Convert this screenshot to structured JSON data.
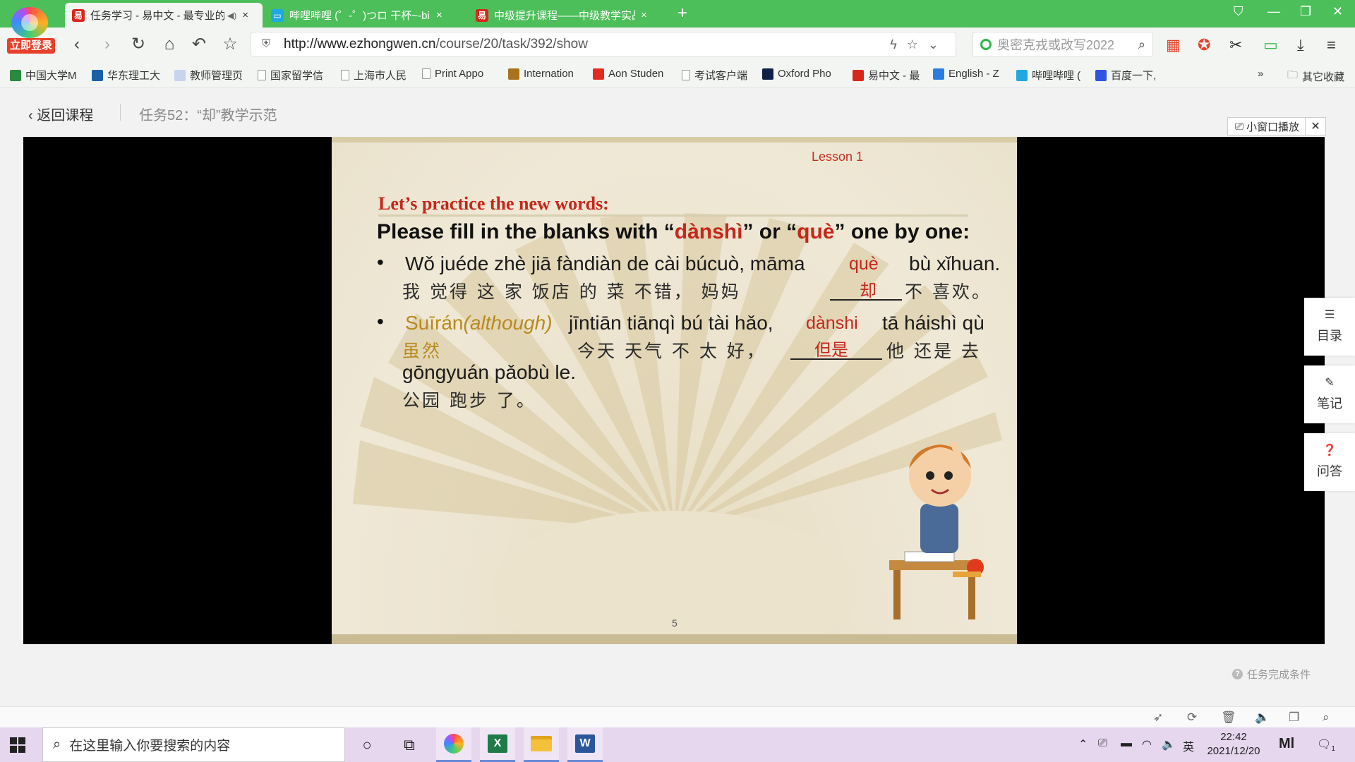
{
  "browser": {
    "login_badge": "立即登录",
    "tabs": [
      {
        "title": "任务学习 - 易中文 - 最专业的",
        "favicon": "易"
      },
      {
        "title": "哔哩哔哩 (゜-゜)つロ 干杯~-bi",
        "favicon": "tv"
      },
      {
        "title": "中级提升课程——中级教学实战",
        "favicon": "易"
      }
    ],
    "close_glyph": "×",
    "new_tab_glyph": "+",
    "url_host": "http://www.ezhongwen.cn",
    "url_path": "/course/20/task/392/show",
    "search_placeholder": "奥密克戎或改写2022",
    "bookmarks": [
      {
        "label": "中国大学M",
        "icon_color": "#2a8a3e"
      },
      {
        "label": "华东理工大",
        "icon_color": "#1a5fa8"
      },
      {
        "label": "教师管理页",
        "icon_color": "#c8d4ef"
      },
      {
        "label": "国家留学信",
        "icon_color": "page"
      },
      {
        "label": "上海市人民",
        "icon_color": "page"
      },
      {
        "label": "Print Appo",
        "icon_color": "page"
      },
      {
        "label": "Internation",
        "icon_color": "#a8731a"
      },
      {
        "label": "Aon Studen",
        "icon_color": "#e32a1e"
      },
      {
        "label": "考试客户端",
        "icon_color": "page"
      },
      {
        "label": "Oxford Pho",
        "icon_color": "#0e2146"
      },
      {
        "label": "易中文 - 最",
        "icon_color": "#d8271c"
      },
      {
        "label": "English - Z",
        "icon_color": "#2a7de0"
      },
      {
        "label": "哔哩哔哩 (",
        "icon_color": "#20a8e0"
      },
      {
        "label": "百度一下,",
        "icon_color": "#2e54e0"
      }
    ],
    "more_bookmarks": "»",
    "other_bookmarks": "其它收藏"
  },
  "page": {
    "back_label": "返回课程",
    "task_title": "任务52：“却”教学示范",
    "mini_window_label": "小窗口播放",
    "side_buttons": [
      {
        "label": "目录",
        "icon": "list-icon"
      },
      {
        "label": "笔记",
        "icon": "pencil-icon"
      },
      {
        "label": "问答",
        "icon": "question-icon"
      }
    ],
    "task_condition": "任务完成条件"
  },
  "slide": {
    "lesson": "Lesson 1",
    "practice_title": "Let’s practice the new words:",
    "instruction_pre": "Please fill in the blanks with “",
    "word1": "dànshì",
    "instruction_mid": "” or “",
    "word2": "què",
    "instruction_post": "” one by one:",
    "bullet": "•",
    "s1_pinyin": "Wǒ juéde zhè jiā fàndiàn de cài búcuò, māma",
    "s1_answer_pinyin": "què",
    "s1_pinyin_end": "bù xǐhuan.",
    "s1_hanzi": "我  觉得  这 家  饭店  的 菜 不错， 妈妈",
    "s1_answer_hanzi": "却",
    "s1_hanzi_end": "不 喜欢。",
    "s2_pinyin_start": "Suīrán",
    "s2_pinyin_although": "(although)",
    "s2_pinyin": "jīntiān tiānqì bú tài hǎo,",
    "s2_answer_pinyin": "dànshi",
    "s2_pinyin_end": "tā háishì qù",
    "s2_hanzi_start": "虽然",
    "s2_hanzi": "今天 天气 不 太 好，",
    "s2_answer_hanzi": "但是",
    "s2_hanzi_end": "他 还是 去",
    "s2_pinyin_line2": "gōngyuán pǎobù le.",
    "s2_hanzi_line2": "公园      跑步  了。",
    "page_number": "5"
  },
  "taskbar": {
    "search_placeholder": "在这里输入你要搜索的内容",
    "ime": "英",
    "time": "22:42",
    "date": "2021/12/20",
    "notification_count": "1"
  },
  "colors": {
    "accent_green": "#4cbf5a",
    "slide_red": "#c4271b",
    "slide_gold": "#b88a1c"
  }
}
